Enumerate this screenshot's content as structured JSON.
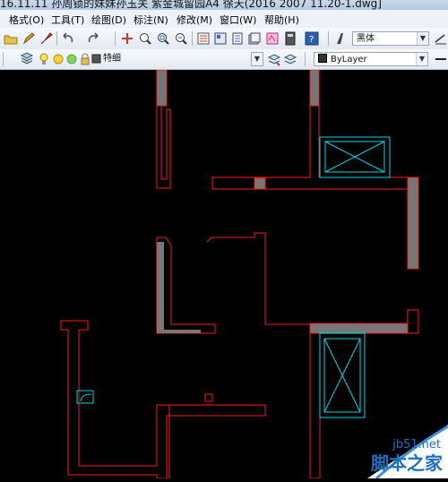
{
  "window": {
    "title": "16.11.11 孙周锁的妹妹孙玉关 紫金城留园A4 徐天(2016 2007  11.20-1.dwg]"
  },
  "menu": {
    "items": [
      "格式(O)",
      "工具(T)",
      "绘图(D)",
      "标注(N)",
      "修改(M)",
      "窗口(W)",
      "帮助(H)"
    ]
  },
  "toolbar1": {
    "text_style_label": "黑体"
  },
  "toolbar2": {
    "layer_name": "特细",
    "linetype_label": "ByLayer"
  },
  "watermark": {
    "site": "jb51.net",
    "brand": "脚本之家"
  },
  "colors": {
    "wall_outline": "#ff1a1a",
    "wall_fill": "#7a7a7a",
    "fixture": "#00d8e8",
    "background": "#000000"
  },
  "icons": [
    "open-folder-icon",
    "pencil-icon",
    "brush-icon",
    "undo-icon",
    "redo-icon",
    "pan-icon",
    "zoom-realtime-icon",
    "zoom-window-icon",
    "zoom-previous-icon",
    "properties-icon",
    "design-center-icon",
    "tool-palette-icon",
    "sheet-set-icon",
    "markup-icon",
    "calculator-icon",
    "help-icon",
    "text-style-icon",
    "dimension-icon",
    "layer-manager-icon",
    "layer-state-icon",
    "lightbulb-icon",
    "sun-icon",
    "lock-icon",
    "color-swatch-icon",
    "make-current-icon",
    "layer-previous-icon"
  ]
}
